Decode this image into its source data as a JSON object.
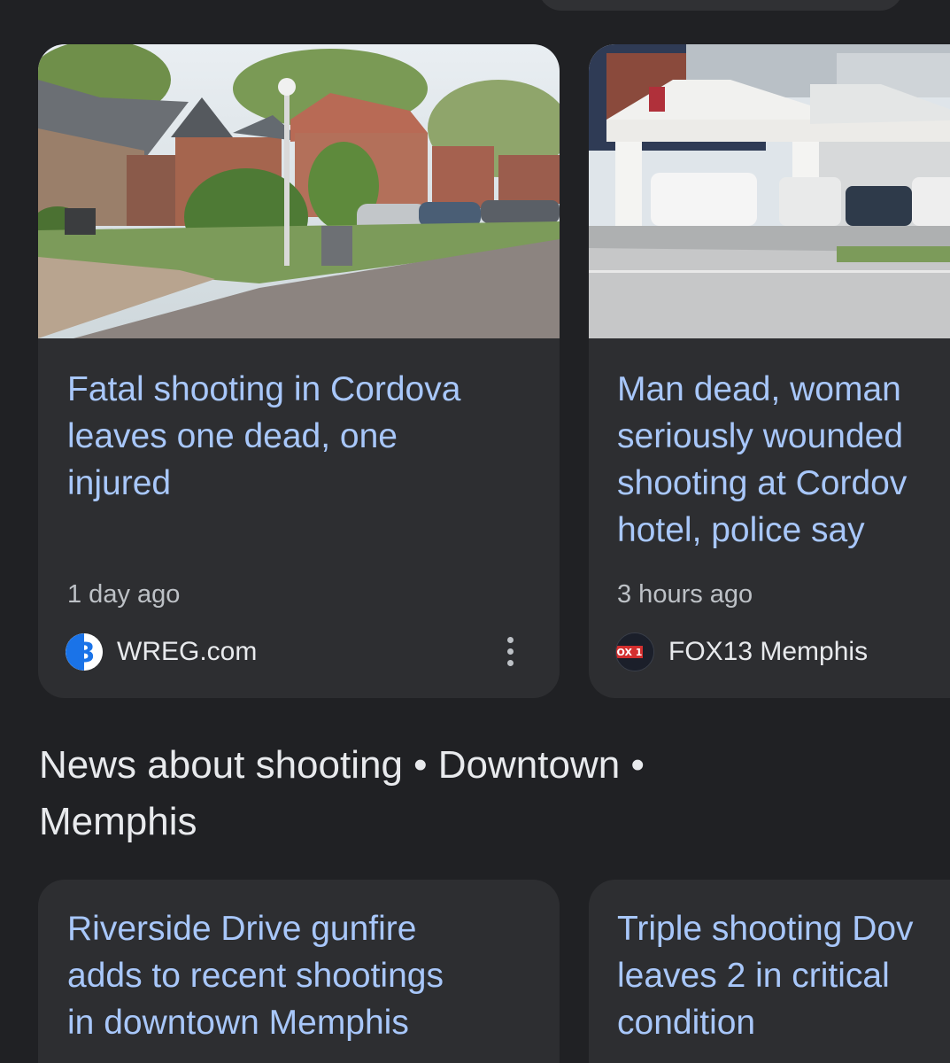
{
  "top_carousel": {
    "cards": [
      {
        "headline_lines": [
          "Fatal shooting in Cordova",
          "leaves one dead, one",
          "injured"
        ],
        "time": "1 day ago",
        "source": "WREG.com",
        "logo_text": "3"
      },
      {
        "headline_lines": [
          "Man dead, woman",
          "seriously wounded",
          "shooting at Cordov",
          "hotel, police say"
        ],
        "time": "3 hours ago",
        "source": "FOX13 Memphis",
        "logo_text": "OX 1"
      }
    ]
  },
  "section": {
    "title_line1": "News about shooting • Downtown •",
    "title_line2": "Memphis"
  },
  "bottom_carousel": {
    "cards": [
      {
        "headline_lines": [
          "Riverside Drive gunfire",
          "adds to recent shootings",
          "in downtown Memphis"
        ]
      },
      {
        "headline_lines": [
          "Triple shooting Dov",
          "leaves 2 in critical",
          "condition"
        ]
      }
    ]
  },
  "colors": {
    "background": "#202124",
    "card": "#2d2e31",
    "headline": "#a8c7fa",
    "meta_text": "#bdc1c6",
    "primary_text": "#e8eaed"
  },
  "icons": {
    "card_menu": "more-vert-icon"
  }
}
